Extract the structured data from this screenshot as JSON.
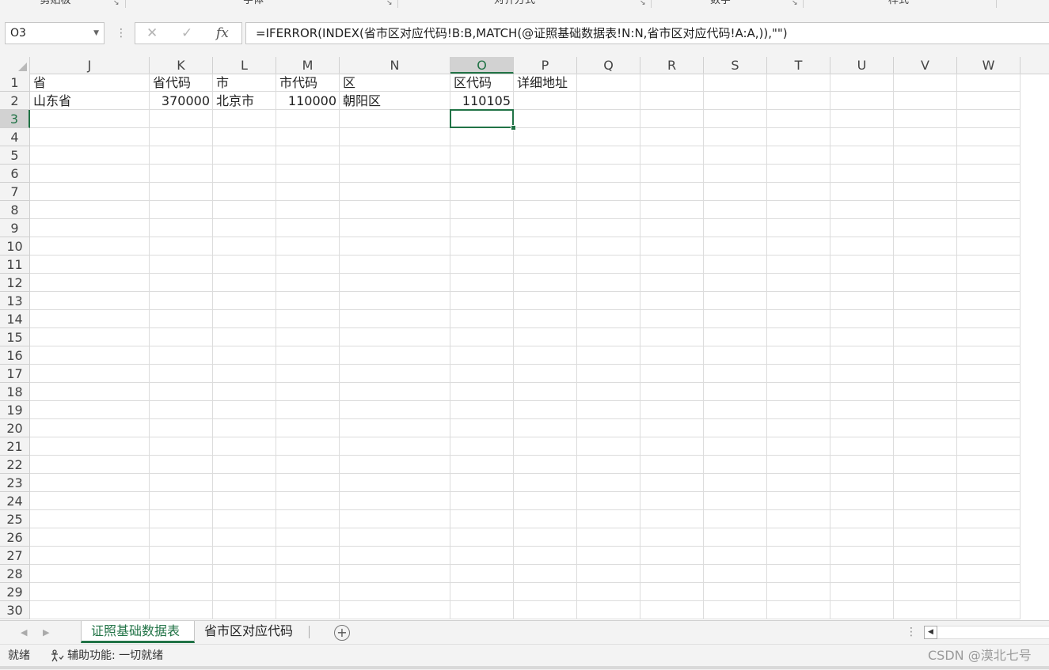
{
  "ribbon": {
    "groups": [
      {
        "label": "剪贴板"
      },
      {
        "label": "字体"
      },
      {
        "label": "对齐方式"
      },
      {
        "label": "数字"
      },
      {
        "label": "样式"
      }
    ]
  },
  "formula_bar": {
    "name_box": "O3",
    "cancel_icon": "✕",
    "enter_icon": "✓",
    "fx_label": "fx",
    "formula": "=IFERROR(INDEX(省市区对应代码!B:B,MATCH(@证照基础数据表!N:N,省市区对应代码!A:A,)),\"\")"
  },
  "columns": [
    "J",
    "K",
    "L",
    "M",
    "N",
    "O",
    "P",
    "Q",
    "R",
    "S",
    "T",
    "U",
    "V",
    "W"
  ],
  "active_column": "O",
  "rows": [
    "1",
    "2",
    "3",
    "4",
    "5",
    "6",
    "7",
    "8",
    "9",
    "10",
    "11",
    "12",
    "13",
    "14",
    "15",
    "16",
    "17",
    "18",
    "19",
    "20",
    "21",
    "22",
    "23",
    "24",
    "25",
    "26",
    "27",
    "28",
    "29",
    "30"
  ],
  "active_row": "3",
  "cells": {
    "J1": "省",
    "K1": "省代码",
    "L1": "市",
    "M1": "市代码",
    "N1": "区",
    "O1": "区代码",
    "P1": "详细地址",
    "J2": "山东省",
    "K2": "370000",
    "L2": "北京市",
    "M2": "110000",
    "N2": "朝阳区",
    "O2": "110105"
  },
  "sheet_tabs": [
    {
      "label": "证照基础数据表",
      "active": true
    },
    {
      "label": "省市区对应代码",
      "active": false
    }
  ],
  "add_sheet_icon": "+",
  "status": {
    "ready": "就绪",
    "accessibility": "辅助功能: 一切就绪"
  },
  "watermark": "CSDN @漠北七号",
  "colors": {
    "accent": "#217346"
  }
}
